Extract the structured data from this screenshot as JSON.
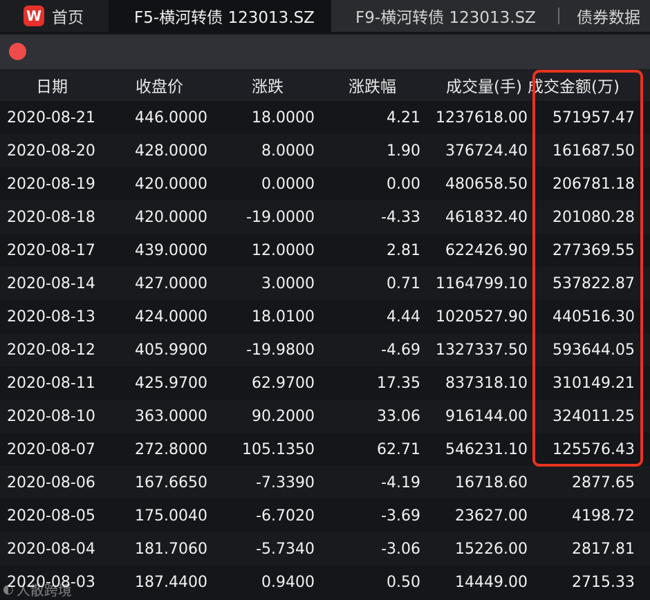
{
  "tabs": {
    "home_logo": "W",
    "home_label": "首页",
    "active_label": "F5-横河转债 123013.SZ",
    "second_label": "F9-横河转债 123013.SZ",
    "third_label": "债券数据"
  },
  "table": {
    "columns": [
      "日期",
      "收盘价",
      "涨跌",
      "涨跌幅",
      "成交量(手)",
      "成交金额(万)"
    ],
    "rows": [
      [
        "2020-08-21",
        "446.0000",
        "18.0000",
        "4.21",
        "1237618.00",
        "571957.47"
      ],
      [
        "2020-08-20",
        "428.0000",
        "8.0000",
        "1.90",
        "376724.40",
        "161687.50"
      ],
      [
        "2020-08-19",
        "420.0000",
        "0.0000",
        "0.00",
        "480658.50",
        "206781.18"
      ],
      [
        "2020-08-18",
        "420.0000",
        "-19.0000",
        "-4.33",
        "461832.40",
        "201080.28"
      ],
      [
        "2020-08-17",
        "439.0000",
        "12.0000",
        "2.81",
        "622426.90",
        "277369.55"
      ],
      [
        "2020-08-14",
        "427.0000",
        "3.0000",
        "0.71",
        "1164799.10",
        "537822.87"
      ],
      [
        "2020-08-13",
        "424.0000",
        "18.0100",
        "4.44",
        "1020527.90",
        "440516.30"
      ],
      [
        "2020-08-12",
        "405.9900",
        "-19.9800",
        "-4.69",
        "1327337.50",
        "593644.05"
      ],
      [
        "2020-08-11",
        "425.9700",
        "62.9700",
        "17.35",
        "837318.10",
        "310149.21"
      ],
      [
        "2020-08-10",
        "363.0000",
        "90.2000",
        "33.06",
        "916144.00",
        "324011.25"
      ],
      [
        "2020-08-07",
        "272.8000",
        "105.1350",
        "62.71",
        "546231.10",
        "125576.43"
      ],
      [
        "2020-08-06",
        "167.6650",
        "-7.3390",
        "-4.19",
        "16718.60",
        "2877.65"
      ],
      [
        "2020-08-05",
        "175.0040",
        "-6.7020",
        "-3.69",
        "23627.00",
        "4198.72"
      ],
      [
        "2020-08-04",
        "181.7060",
        "-5.7340",
        "-3.06",
        "15226.00",
        "2817.81"
      ],
      [
        "2020-08-03",
        "187.4400",
        "0.9400",
        "0.50",
        "14449.00",
        "2715.33"
      ]
    ]
  },
  "watermark": {
    "text": "人散跨境"
  },
  "colors": {
    "background": "#15161a",
    "highlight_border": "#e8321f",
    "close_button": "#ee4c4a",
    "logo": "#e6312b"
  }
}
